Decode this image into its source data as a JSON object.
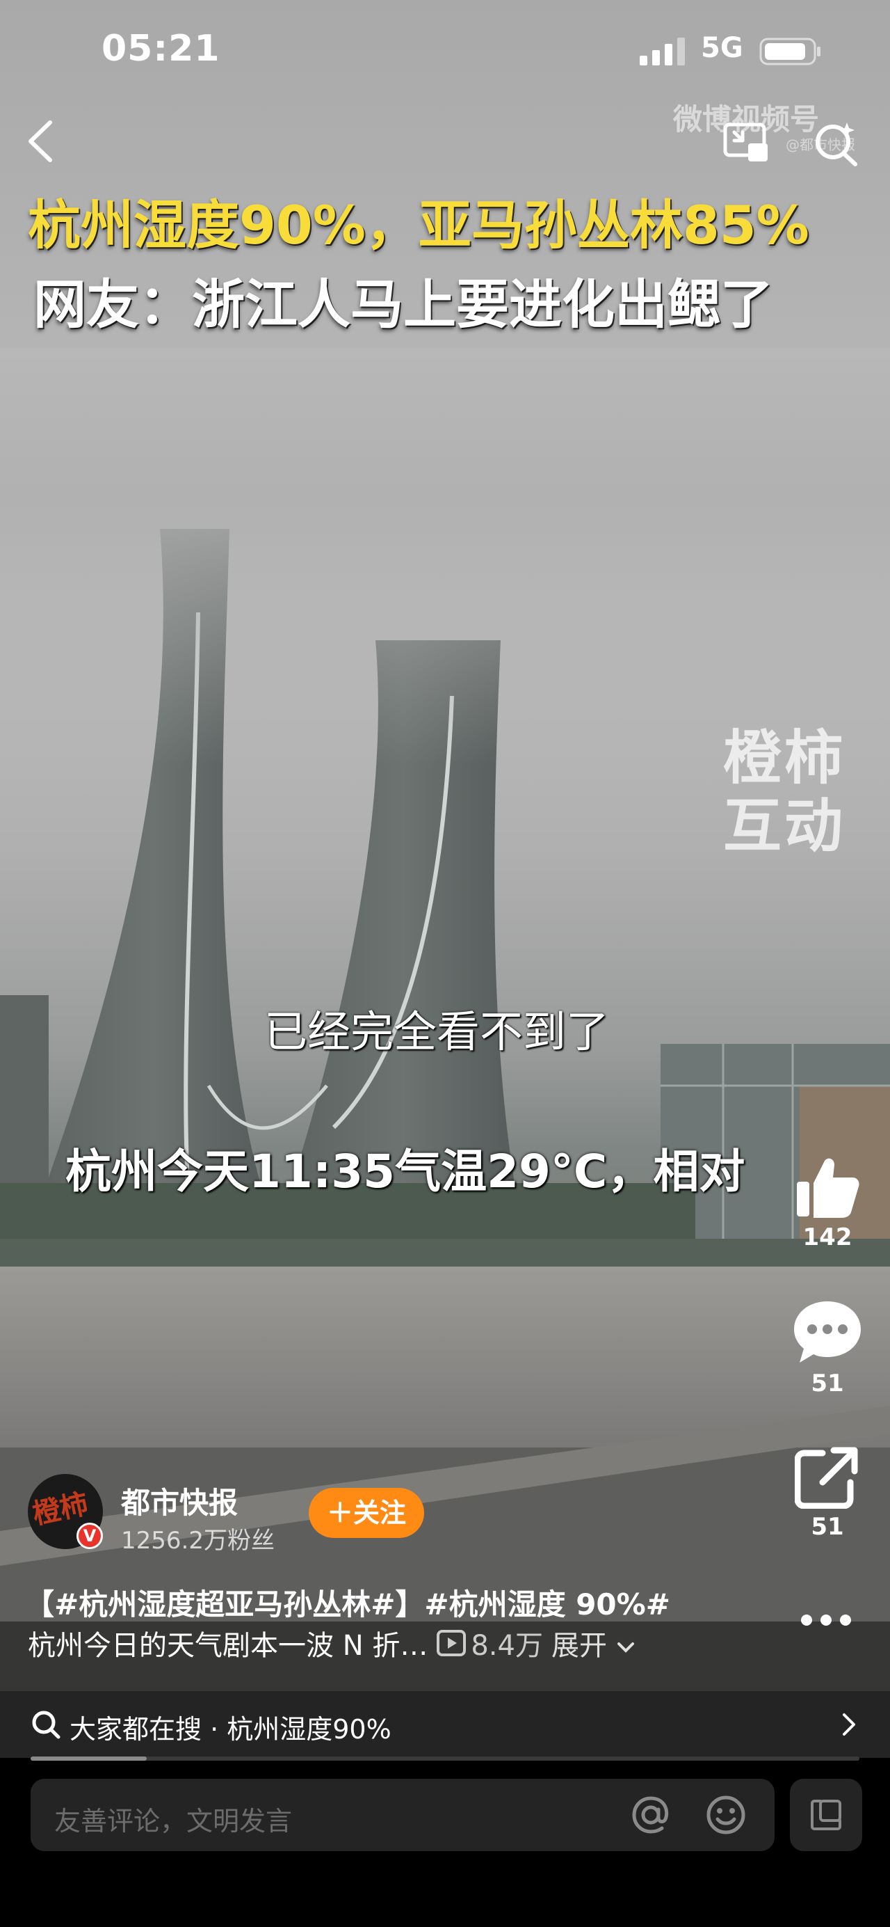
{
  "status_bar": {
    "time": "05:21",
    "network": "5G"
  },
  "video": {
    "watermark_weibo": "微博视频号",
    "watermark_handle": "@都市快报",
    "headline_line1": "杭州湿度90%，亚马孙丛林85%",
    "headline_line2": "网友：浙江人马上要进化出鳃了",
    "brand_watermark": "橙柿互动",
    "subtitle_1": "已经完全看不到了",
    "subtitle_2": "杭州今天11:35气温29°C，相对"
  },
  "actions": {
    "likes": "142",
    "comments": "51",
    "shares": "51"
  },
  "author": {
    "avatar_text": "橙柿",
    "name": "都市快报",
    "fans": "1256.2万粉丝",
    "follow_label": "＋关注"
  },
  "post": {
    "tags": "【#杭州湿度超亚马孙丛林#】#杭州湿度 90%#",
    "text": "杭州今日的天气剧本一波 N 折…",
    "views": "8.4万",
    "expand_label": "展开"
  },
  "hot_search": {
    "text": "大家都在搜 · 杭州湿度90%",
    "progress": 0.14
  },
  "comment_box": {
    "placeholder": "友善评论，文明发言"
  },
  "colors": {
    "follow_button": "#ff8a14",
    "headline_yellow": "#f7dc3a",
    "verified_badge": "#e8342a"
  },
  "icons": [
    "back-icon",
    "picture-in-picture-icon",
    "search-icon",
    "thumbs-up-icon",
    "comment-icon",
    "share-icon",
    "more-icon",
    "at-icon",
    "emoji-icon",
    "expand-icon",
    "chevron-right-icon",
    "play-icon"
  ]
}
